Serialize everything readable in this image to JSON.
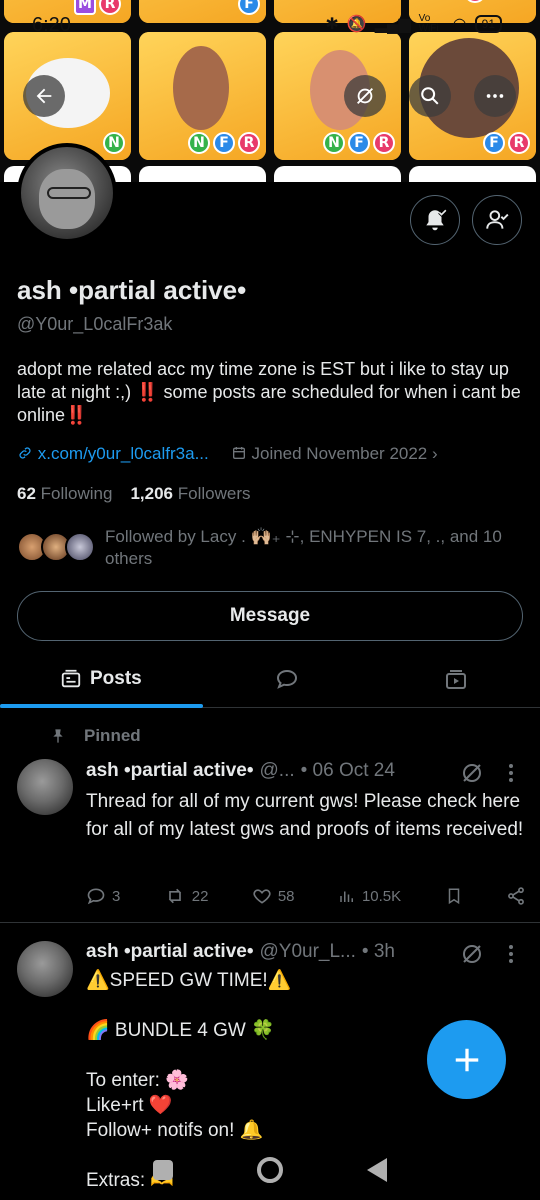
{
  "status_bar": {
    "time": "6:20",
    "battery": "91",
    "icons": [
      "bluetooth-icon",
      "mute-icon",
      "signal-icon",
      "vowifi-icon",
      "wifi-icon"
    ],
    "vowifi": "Vo WiFi"
  },
  "banner": {
    "tile_tags": [
      [
        "M",
        "R"
      ],
      [
        "F"
      ],
      [],
      [
        "R"
      ],
      [
        "N"
      ],
      [
        "N",
        "F",
        "R"
      ],
      [
        "N",
        "F",
        "R"
      ],
      [
        "F",
        "R"
      ]
    ]
  },
  "top_actions": {
    "back_icon": "back-arrow-icon",
    "hide_icon": "eye-off-icon",
    "search_icon": "search-icon",
    "more_icon": "more-icon"
  },
  "profile": {
    "name": "ash •partial active•",
    "handle": "@Y0ur_L0calFr3ak",
    "bio_line1": "adopt me related acc my time zone is EST but i like to stay up late at night :,)",
    "bio_mark1": "‼️",
    "bio_line2": " some posts are scheduled for when i cant be online",
    "bio_mark2": "‼️",
    "link": "x.com/y0ur_l0calfr3a...",
    "joined": "Joined November 2022",
    "following_count": "62",
    "following_label": "Following",
    "followers_count": "1,206",
    "followers_label": "Followers",
    "followed_by": "Followed by Lacy . 🙌🏼₊ ⊹, ENHYPEN IS 7, ., and 10 others",
    "message_label": "Message"
  },
  "tabs": {
    "posts_label": "Posts"
  },
  "pinned_label": "Pinned",
  "posts": [
    {
      "name": "ash •partial active•",
      "handle": "@...",
      "time": "• 06 Oct 24",
      "body": "Thread for all of my current gws! Please check here for all of my latest gws and proofs of items received!",
      "replies": "3",
      "reposts": "22",
      "likes": "58",
      "views": "10.5K"
    },
    {
      "name": "ash •partial active•",
      "handle": "@Y0ur_L...",
      "time": "• 3h",
      "body": "⚠️SPEED GW TIME!⚠️\n\n🌈 BUNDLE 4 GW 🍀\n\nTo enter: 🌸\nLike+rt ❤️\nFollow+ notifs on! 🔔\n\nExtras: 🫶"
    }
  ],
  "fab_icon": "plus-icon",
  "colors": {
    "accent": "#1d9bf0",
    "background": "#000000",
    "text": "#e7e9ea",
    "muted": "#71767b",
    "border": "#2f3336"
  }
}
